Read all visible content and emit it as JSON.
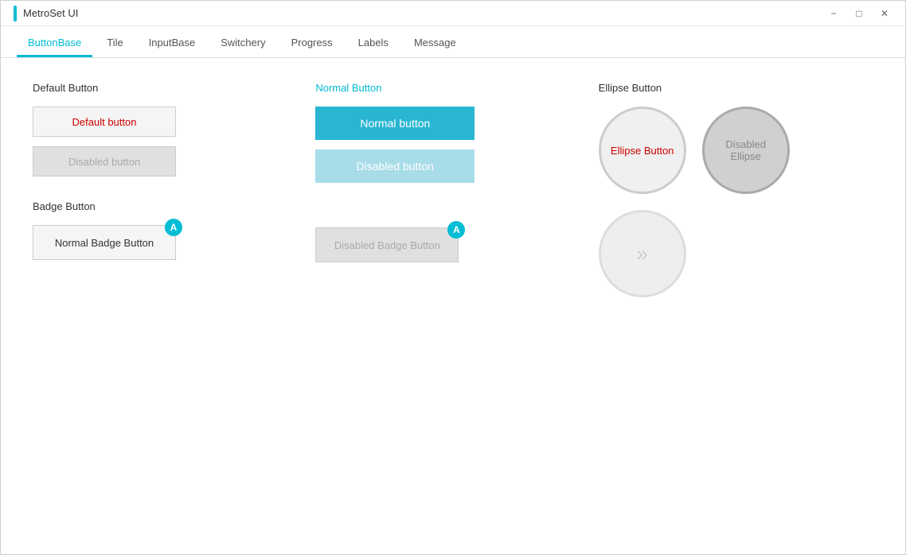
{
  "window": {
    "title": "MetroSet UI",
    "accent_color": "#00bcd4"
  },
  "titlebar": {
    "minimize_label": "−",
    "maximize_label": "□",
    "close_label": "✕"
  },
  "tabs": {
    "items": [
      {
        "label": "ButtonBase",
        "active": true
      },
      {
        "label": "Tile",
        "active": false
      },
      {
        "label": "InputBase",
        "active": false
      },
      {
        "label": "Switchery",
        "active": false
      },
      {
        "label": "Progress",
        "active": false
      },
      {
        "label": "Labels",
        "active": false
      },
      {
        "label": "Message",
        "active": false
      }
    ]
  },
  "sections": {
    "default_button": {
      "title": "Default Button",
      "normal_label": "Default button",
      "disabled_label": "Disabled button"
    },
    "normal_button": {
      "title": "Normal Button",
      "normal_label": "Normal button",
      "disabled_label": "Disabled button"
    },
    "ellipse_button": {
      "title": "Ellipse Button",
      "ellipse_label": "Ellipse Button",
      "disabled_label": "Disabled Ellipse",
      "arrow_label": "»"
    },
    "badge_button": {
      "title": "Badge Button",
      "normal_label": "Normal Badge Button",
      "disabled_label": "Disabled Badge Button",
      "badge_text": "A"
    }
  }
}
